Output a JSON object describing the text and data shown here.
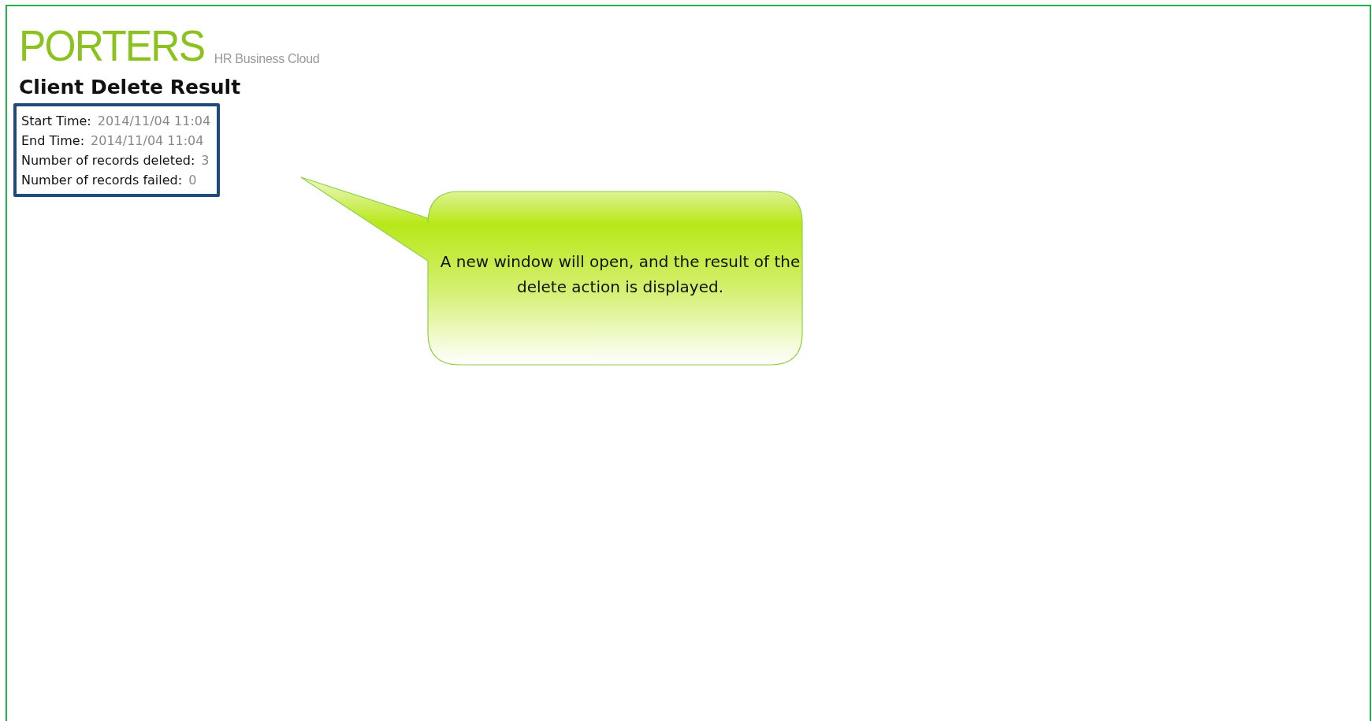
{
  "logo": {
    "brand": "PORTERS",
    "tagline": "HR Business Cloud"
  },
  "title": "Client Delete Result",
  "result": {
    "rows": [
      {
        "label": "Start Time:",
        "value": "2014/11/04 11:04"
      },
      {
        "label": "End Time:",
        "value": "2014/11/04 11:04"
      },
      {
        "label": "Number of records deleted:",
        "value": "3"
      },
      {
        "label": "Number of records failed:",
        "value": "0"
      }
    ]
  },
  "callout": {
    "text": "A new window will open, and the result of the delete action is displayed."
  }
}
